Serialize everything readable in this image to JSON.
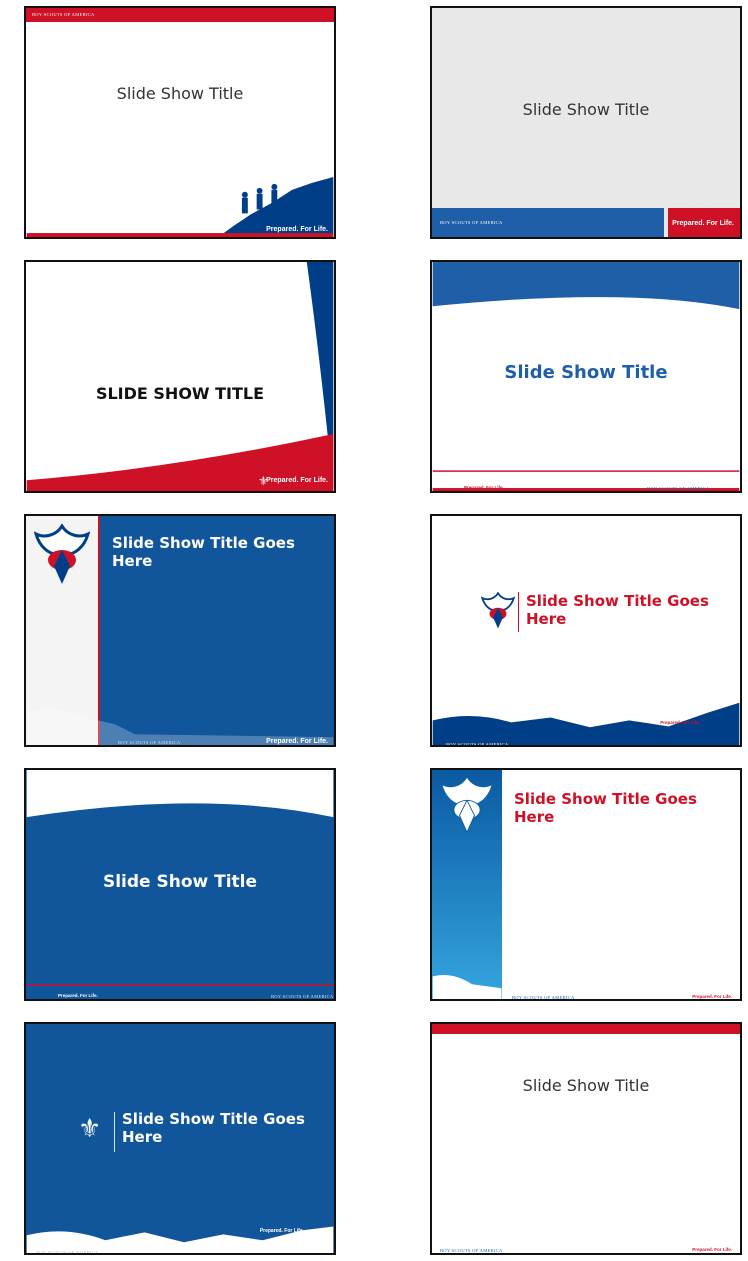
{
  "slides": [
    {
      "title": "Slide Show Title",
      "org": "BOY SCOUTS OF AMERICA",
      "tagline": "Prepared. For Life."
    },
    {
      "title": "Slide Show Title",
      "org": "BOY SCOUTS OF AMERICA",
      "tagline": "Prepared. For Life."
    },
    {
      "title": "SLIDE SHOW TITLE",
      "tagline": "Prepared. For Life."
    },
    {
      "title": "Slide Show Title",
      "org": "BOY SCOUTS OF AMERICA",
      "tagline": "Prepared. For Life."
    },
    {
      "title": "Slide Show Title Goes Here",
      "org": "BOY SCOUTS OF AMERICA",
      "tagline": "Prepared. For Life."
    },
    {
      "title": "Slide Show Title Goes Here",
      "org": "BOY SCOUTS OF AMERICA",
      "tagline": "Prepared. For Life."
    },
    {
      "title": "Slide Show Title",
      "org": "BOY SCOUTS OF AMERICA",
      "tagline": "Prepared. For Life."
    },
    {
      "title": "Slide Show Title Goes Here",
      "org": "BOY SCOUTS OF AMERICA",
      "tagline": "Prepared. For Life."
    },
    {
      "title": "Slide Show Title Goes Here",
      "org": "BOY SCOUTS OF AMERICA",
      "tagline": "Prepared. For Life."
    },
    {
      "title": "Slide Show Title",
      "org": "BOY SCOUTS OF AMERICA",
      "tagline": "Prepared. For Life."
    }
  ],
  "colors": {
    "red": "#ce1126",
    "navy": "#003f87",
    "blue": "#1e5fa8",
    "gray": "#e8e8e8"
  }
}
